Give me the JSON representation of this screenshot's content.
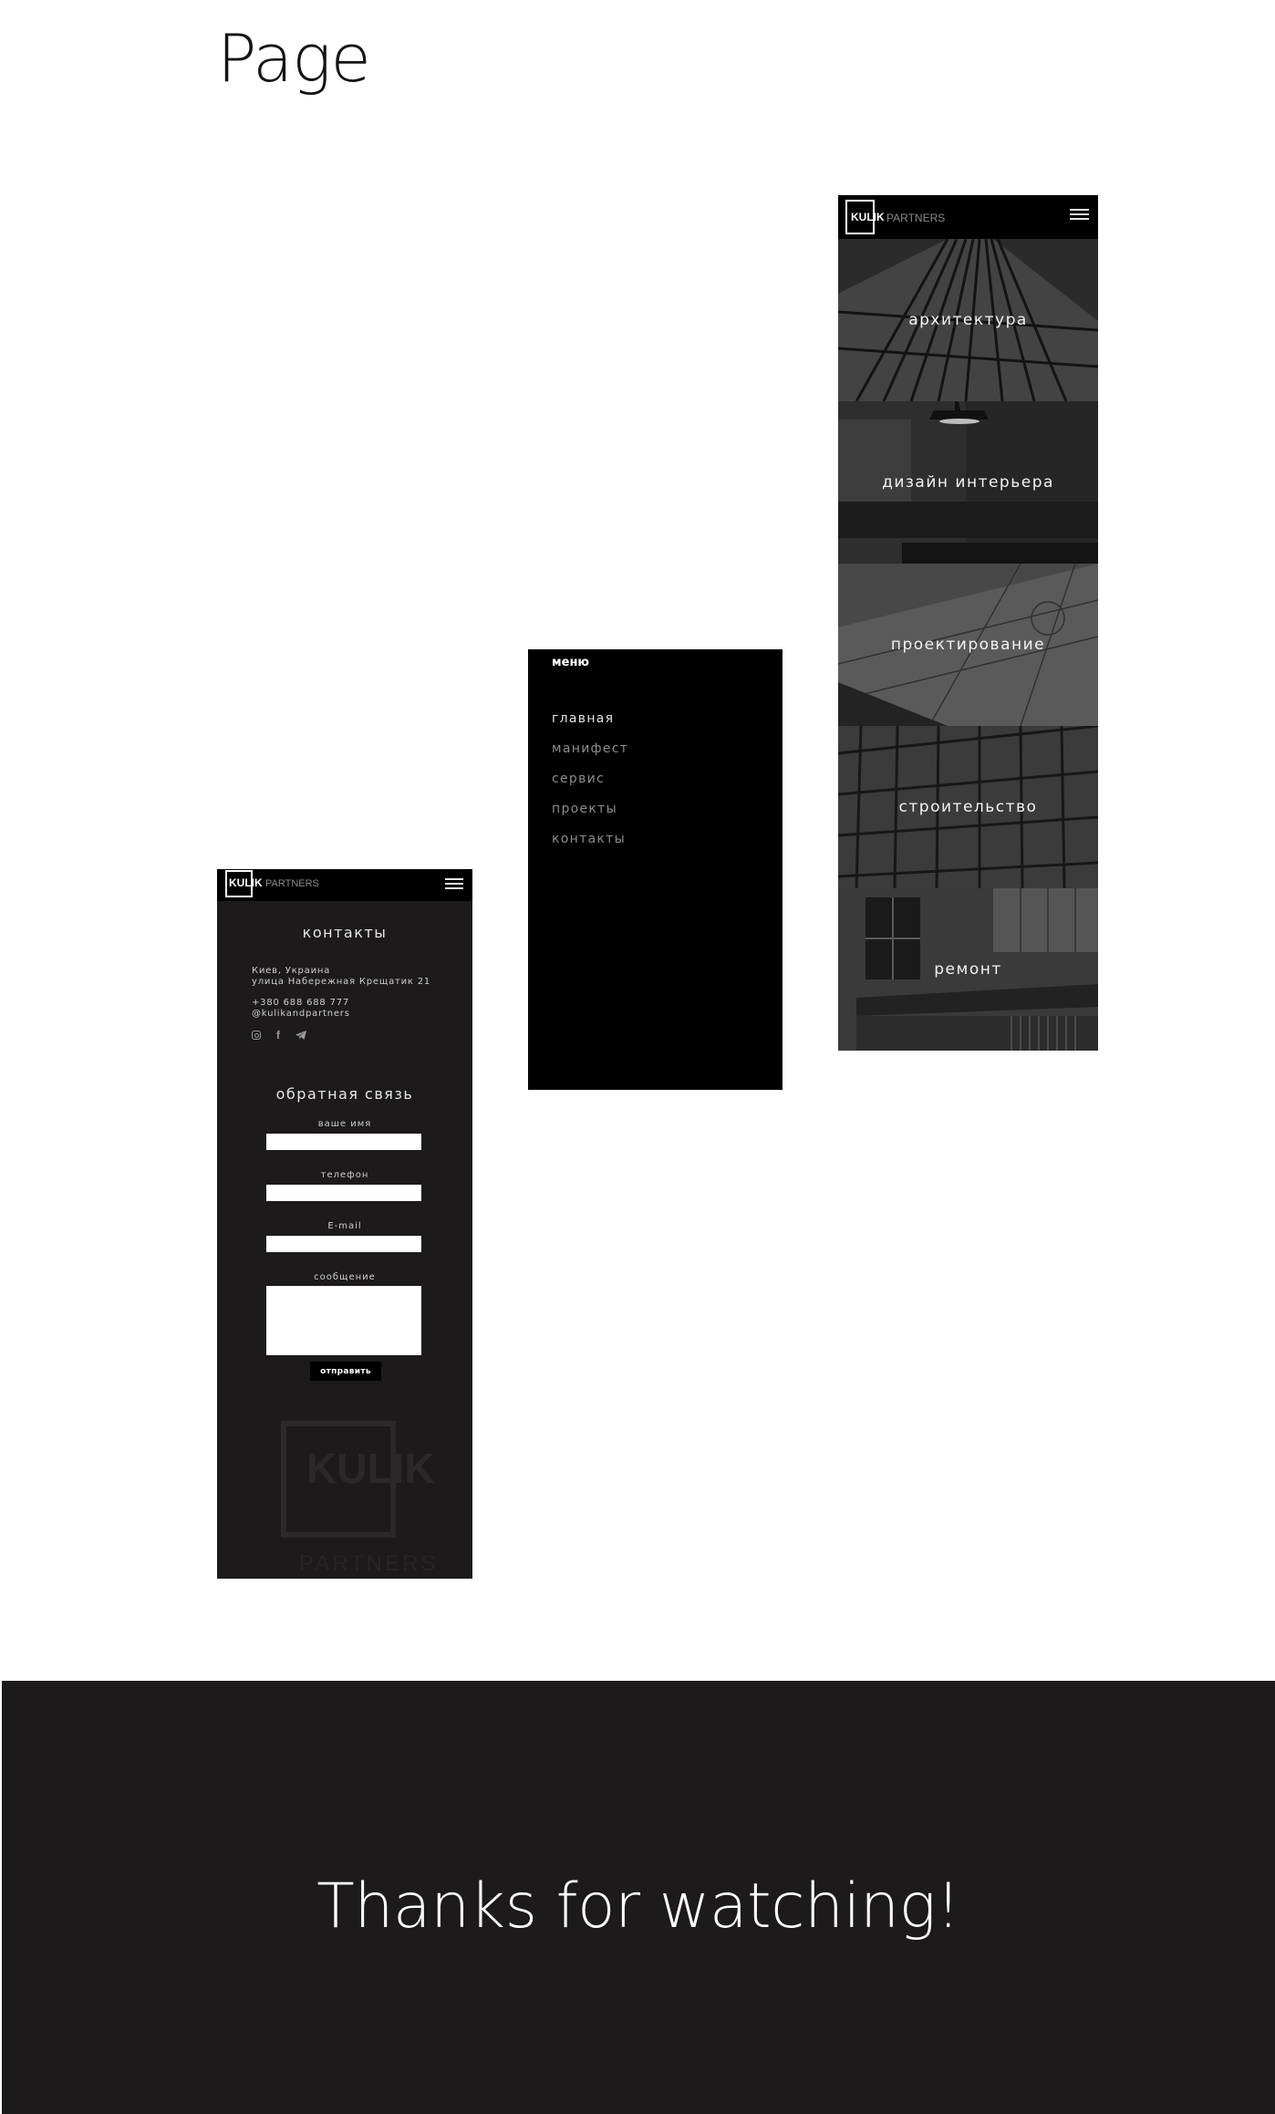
{
  "page": {
    "title": "Page"
  },
  "brand": {
    "logo": "KULIK",
    "sub": "PARTNERS"
  },
  "contacts_screen": {
    "heading": "контакты",
    "address_line1": "Киев, Украина",
    "address_line2": "улица Набережная Крещатик 21",
    "phone": "+380 688 688 777",
    "handle": "@kulikandpartners",
    "social_icons": [
      "instagram-icon",
      "facebook-icon",
      "telegram-icon"
    ],
    "feedback_heading": "обратная связь",
    "form": {
      "name_label": "ваше имя",
      "phone_label": "телефон",
      "email_label": "E-mail",
      "message_label": "сообщение",
      "submit_label": "отправить"
    },
    "watermark": {
      "logo": "KULIK",
      "sub": "PARTNERS"
    }
  },
  "menu_screen": {
    "title": "меню",
    "items": [
      {
        "label": "главная",
        "active": true
      },
      {
        "label": "манифест",
        "active": false
      },
      {
        "label": "сервис",
        "active": false
      },
      {
        "label": "проекты",
        "active": false
      },
      {
        "label": "контакты",
        "active": false
      }
    ]
  },
  "services_screen": {
    "tiles": [
      {
        "label": "архитектура"
      },
      {
        "label": "дизайн интерьера"
      },
      {
        "label": "проектирование"
      },
      {
        "label": "строительство"
      },
      {
        "label": "ремонт"
      }
    ]
  },
  "footer": {
    "text": "Thanks for watching!"
  },
  "colors": {
    "background": "#ffffff",
    "dark_panel": "#1c1a1b",
    "black": "#000000",
    "text_light": "#e6e6e6",
    "text_muted": "#8d8d8d"
  }
}
